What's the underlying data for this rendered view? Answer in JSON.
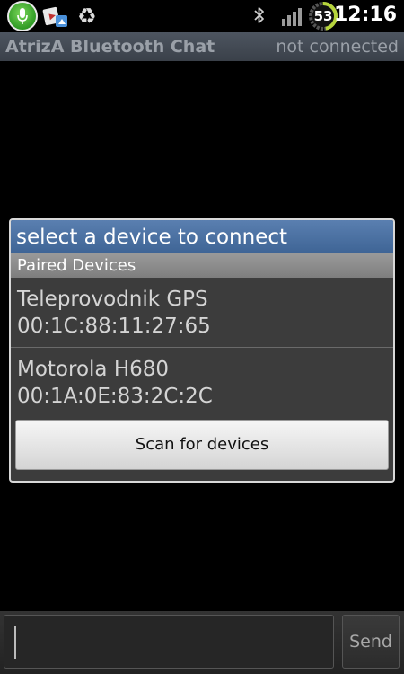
{
  "statusbar": {
    "time": "12:16",
    "battery_level": "53",
    "icons": [
      "mic-icon",
      "media-icon",
      "recycle-icon",
      "bluetooth-icon",
      "signal-icon",
      "battery-icon"
    ]
  },
  "app": {
    "title": "AtrizA Bluetooth Chat",
    "connection_status": "not connected"
  },
  "dialog": {
    "title": "select a device to connect",
    "section_header": "Paired Devices",
    "devices": [
      {
        "name": "Teleprovodnik GPS",
        "address": "00:1C:88:11:27:65"
      },
      {
        "name": "Motorola H680",
        "address": "00:1A:0E:83:2C:2C"
      }
    ],
    "scan_label": "Scan for devices"
  },
  "composer": {
    "input_value": "",
    "send_label": "Send"
  },
  "colors": {
    "title_bar": "#3f6596",
    "battery_ring": "#b6d43c",
    "mic_green": "#2f9a24"
  }
}
